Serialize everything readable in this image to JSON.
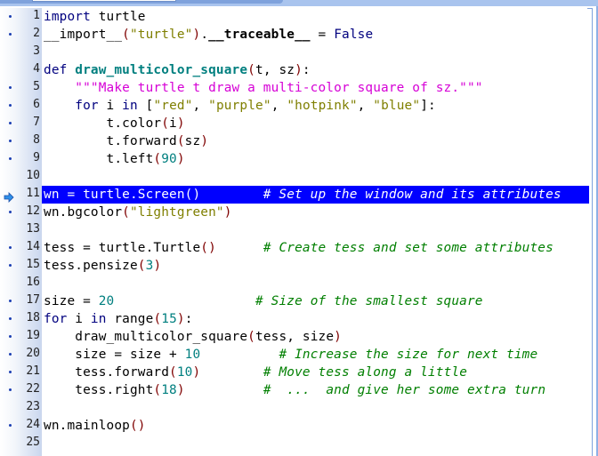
{
  "editor": {
    "current_line": 11,
    "lines": [
      {
        "n": "1",
        "marker": "dot",
        "tokens": [
          [
            "kw",
            "import"
          ],
          [
            "nm",
            " turtle"
          ]
        ]
      },
      {
        "n": "2",
        "marker": "dot",
        "tokens": [
          [
            "nm",
            "__import__"
          ],
          [
            "par",
            "("
          ],
          [
            "str",
            "\"turtle\""
          ],
          [
            "par",
            ")"
          ],
          [
            "nm",
            "."
          ],
          [
            "dunder",
            "__traceable__"
          ],
          [
            "op",
            " = "
          ],
          [
            "kw",
            "False"
          ]
        ]
      },
      {
        "n": "3",
        "marker": "none",
        "tokens": []
      },
      {
        "n": "4",
        "marker": "none",
        "tokens": [
          [
            "kw",
            "def "
          ],
          [
            "defn",
            "draw_multicolor_square"
          ],
          [
            "par",
            "("
          ],
          [
            "nm",
            "t, sz"
          ],
          [
            "par",
            ")"
          ],
          [
            "nm",
            ":"
          ]
        ]
      },
      {
        "n": "5",
        "marker": "dot",
        "tokens": [
          [
            "nm",
            "    "
          ],
          [
            "doc",
            "\"\"\"Make turtle t draw a multi-color square of sz.\"\"\""
          ]
        ]
      },
      {
        "n": "6",
        "marker": "dot",
        "tokens": [
          [
            "nm",
            "    "
          ],
          [
            "kw",
            "for"
          ],
          [
            "nm",
            " i "
          ],
          [
            "kw",
            "in"
          ],
          [
            "nm",
            " ["
          ],
          [
            "str",
            "\"red\""
          ],
          [
            "nm",
            ", "
          ],
          [
            "str",
            "\"purple\""
          ],
          [
            "nm",
            ", "
          ],
          [
            "str",
            "\"hotpink\""
          ],
          [
            "nm",
            ", "
          ],
          [
            "str",
            "\"blue\""
          ],
          [
            "nm",
            "]:"
          ]
        ]
      },
      {
        "n": "7",
        "marker": "dot",
        "tokens": [
          [
            "nm",
            "        t.color"
          ],
          [
            "par",
            "("
          ],
          [
            "nm",
            "i"
          ],
          [
            "par",
            ")"
          ]
        ]
      },
      {
        "n": "8",
        "marker": "dot",
        "tokens": [
          [
            "nm",
            "        t.forward"
          ],
          [
            "par",
            "("
          ],
          [
            "nm",
            "sz"
          ],
          [
            "par",
            ")"
          ]
        ]
      },
      {
        "n": "9",
        "marker": "dot",
        "tokens": [
          [
            "nm",
            "        t.left"
          ],
          [
            "par",
            "("
          ],
          [
            "num",
            "90"
          ],
          [
            "par",
            ")"
          ]
        ]
      },
      {
        "n": "10",
        "marker": "none",
        "tokens": []
      },
      {
        "n": "11",
        "marker": "arrow",
        "tokens": [
          [
            "nm",
            "wn = turtle.Screen()        "
          ],
          [
            "cm",
            "# Set up the window and its attributes"
          ]
        ]
      },
      {
        "n": "12",
        "marker": "dot",
        "tokens": [
          [
            "nm",
            "wn.bgcolor"
          ],
          [
            "par",
            "("
          ],
          [
            "str",
            "\"lightgreen\""
          ],
          [
            "par",
            ")"
          ]
        ]
      },
      {
        "n": "13",
        "marker": "none",
        "tokens": []
      },
      {
        "n": "14",
        "marker": "dot",
        "tokens": [
          [
            "nm",
            "tess = turtle.Turtle"
          ],
          [
            "par",
            "()"
          ],
          [
            "nm",
            "      "
          ],
          [
            "cm",
            "# Create tess and set some attributes"
          ]
        ]
      },
      {
        "n": "15",
        "marker": "dot",
        "tokens": [
          [
            "nm",
            "tess.pensize"
          ],
          [
            "par",
            "("
          ],
          [
            "num",
            "3"
          ],
          [
            "par",
            ")"
          ]
        ]
      },
      {
        "n": "16",
        "marker": "none",
        "tokens": []
      },
      {
        "n": "17",
        "marker": "dot",
        "tokens": [
          [
            "nm",
            "size = "
          ],
          [
            "num",
            "20"
          ],
          [
            "nm",
            "                  "
          ],
          [
            "cm",
            "# Size of the smallest square"
          ]
        ]
      },
      {
        "n": "18",
        "marker": "dot",
        "tokens": [
          [
            "kw",
            "for"
          ],
          [
            "nm",
            " i "
          ],
          [
            "kw",
            "in"
          ],
          [
            "nm",
            " range"
          ],
          [
            "par",
            "("
          ],
          [
            "num",
            "15"
          ],
          [
            "par",
            ")"
          ],
          [
            "nm",
            ":"
          ]
        ]
      },
      {
        "n": "19",
        "marker": "dot",
        "tokens": [
          [
            "nm",
            "    draw_multicolor_square"
          ],
          [
            "par",
            "("
          ],
          [
            "nm",
            "tess, size"
          ],
          [
            "par",
            ")"
          ]
        ]
      },
      {
        "n": "20",
        "marker": "dot",
        "tokens": [
          [
            "nm",
            "    size = size + "
          ],
          [
            "num",
            "10"
          ],
          [
            "nm",
            "          "
          ],
          [
            "cm",
            "# Increase the size for next time"
          ]
        ]
      },
      {
        "n": "21",
        "marker": "dot",
        "tokens": [
          [
            "nm",
            "    tess.forward"
          ],
          [
            "par",
            "("
          ],
          [
            "num",
            "10"
          ],
          [
            "par",
            ")"
          ],
          [
            "nm",
            "        "
          ],
          [
            "cm",
            "# Move tess along a little"
          ]
        ]
      },
      {
        "n": "22",
        "marker": "dot",
        "tokens": [
          [
            "nm",
            "    tess.right"
          ],
          [
            "par",
            "("
          ],
          [
            "num",
            "18"
          ],
          [
            "par",
            ")"
          ],
          [
            "nm",
            "          "
          ],
          [
            "cm",
            "#  ...  and give her some extra turn"
          ]
        ]
      },
      {
        "n": "23",
        "marker": "none",
        "tokens": []
      },
      {
        "n": "24",
        "marker": "dot",
        "tokens": [
          [
            "nm",
            "wn.mainloop"
          ],
          [
            "par",
            "()"
          ]
        ]
      },
      {
        "n": "25",
        "marker": "none",
        "tokens": []
      }
    ]
  }
}
